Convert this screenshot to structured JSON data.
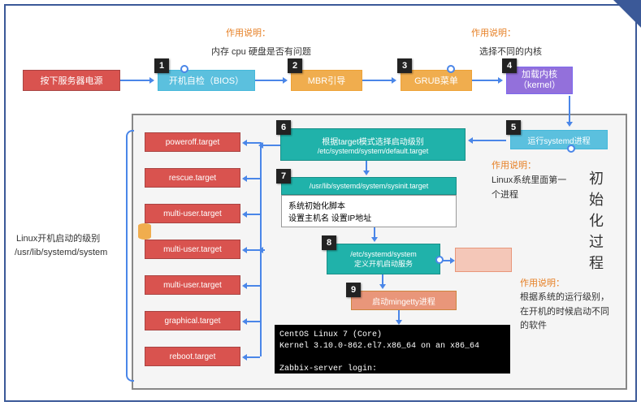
{
  "top": {
    "desc1_label": "作用说明：",
    "desc1_text": "内存 cpu 硬盘是否有问题",
    "desc2_label": "作用说明：",
    "desc2_text": "选择不同的内核",
    "power": "按下服务器电源",
    "bios": "开机自检（BIOS）",
    "mbr": "MBR引导",
    "grub": "GRUB菜单",
    "kernel": "加载内核\n（kernel）"
  },
  "side": {
    "caption1": "Linux开机启动的级别",
    "caption2": "/usr/lib/systemd/system",
    "targets": [
      "poweroff.target",
      "rescue.target",
      "multi-user.target",
      "multi-user.target",
      "multi-user.target",
      "graphical.target",
      "reboot.target"
    ]
  },
  "center": {
    "step5": "运行systemd进程",
    "step5_desc_label": "作用说明：",
    "step5_desc": "Linux系统里面第一个进程",
    "step6a": "根据target模式选择启动级别",
    "step6b": "/etc/systemd/system/default.target",
    "step7": "/usr/lib/systemd/system/sysinit.target",
    "step7_sub1": "系统初始化脚本",
    "step7_sub2": "设置主机名 设置IP地址",
    "step8a": "/etc/systemd/system",
    "step8b": "定义开机启动服务",
    "step8_desc_label": "作用说明：",
    "step8_desc": "根据系统的运行级别，在开机的时候启动不同的软件",
    "step9": "启动mingetty进程",
    "vtitle": "初始化过程"
  },
  "terminal": {
    "line1": "CentOS Linux 7 (Core)",
    "line2": "Kernel 3.10.0-862.el7.x86_64 on an x86_64",
    "line3": "Zabbix-server login:"
  },
  "nums": {
    "n1": "1",
    "n2": "2",
    "n3": "3",
    "n4": "4",
    "n5": "5",
    "n6": "6",
    "n7": "7",
    "n8": "8",
    "n9": "9"
  }
}
